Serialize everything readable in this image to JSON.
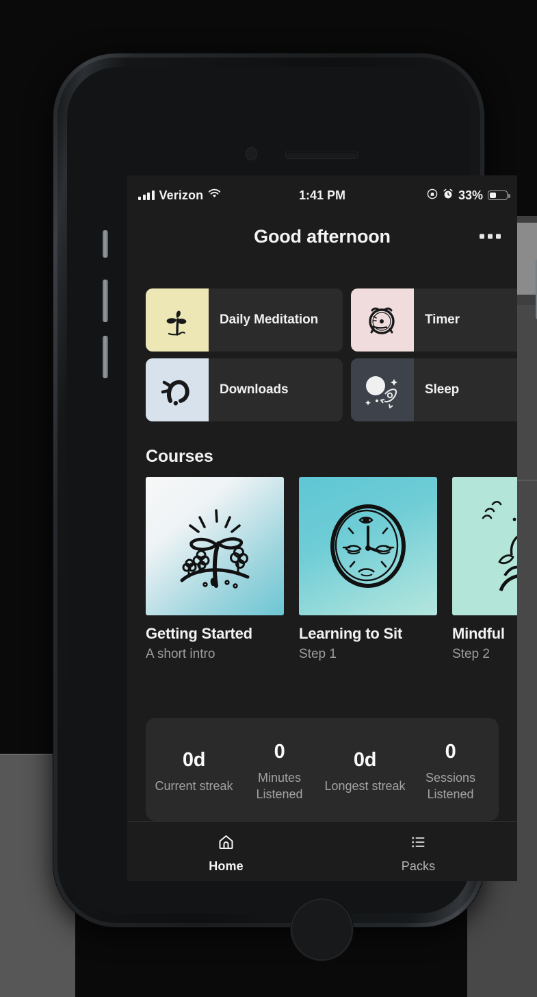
{
  "status_bar": {
    "carrier": "Verizon",
    "signal_icon": "cellular-bars-icon",
    "wifi_icon": "wifi-icon",
    "time": "1:41 PM",
    "rotation_lock_icon": "rotation-lock-icon",
    "alarm_icon": "alarm-clock-icon",
    "battery_percent": "33%",
    "battery_icon": "battery-icon",
    "battery_level": 33
  },
  "header": {
    "greeting": "Good afternoon",
    "more_icon": "more-horizontal-icon"
  },
  "quick_tiles": [
    {
      "label": "Daily Meditation",
      "icon": "sprout-plant-icon",
      "thumb_color": "#ece7b4"
    },
    {
      "label": "Timer",
      "icon": "alarm-clock-icon",
      "thumb_color": "#f0dcdc"
    },
    {
      "label": "Downloads",
      "icon": "magnet-icon",
      "thumb_color": "#d7e2ec"
    },
    {
      "label": "Sleep",
      "icon": "moon-rocket-icon",
      "thumb_color": "#3d424b"
    }
  ],
  "courses_section": {
    "title": "Courses",
    "items": [
      {
        "title": "Getting Started",
        "subtitle": "A short intro",
        "art": "seedling-flowers-art"
      },
      {
        "title": "Learning to Sit",
        "subtitle": "Step 1",
        "art": "clock-face-art"
      },
      {
        "title": "Mindful",
        "subtitle": "Step 2",
        "art": "figure-nature-art"
      }
    ]
  },
  "stats": [
    {
      "value": "0d",
      "label": "Current streak"
    },
    {
      "value": "0",
      "label": "Minutes Listened"
    },
    {
      "value": "0d",
      "label": "Longest streak"
    },
    {
      "value": "0",
      "label": "Sessions Listened"
    }
  ],
  "tab_bar": [
    {
      "label": "Home",
      "icon": "home-icon",
      "active": true
    },
    {
      "label": "Packs",
      "icon": "list-icon",
      "active": false
    }
  ],
  "colors": {
    "screen_bg": "#1c1c1c",
    "tile_bg": "#2b2b2b",
    "card_bg": "#2a2a2a",
    "text_primary": "#f2f2f2",
    "text_secondary": "#9d9d9d"
  }
}
